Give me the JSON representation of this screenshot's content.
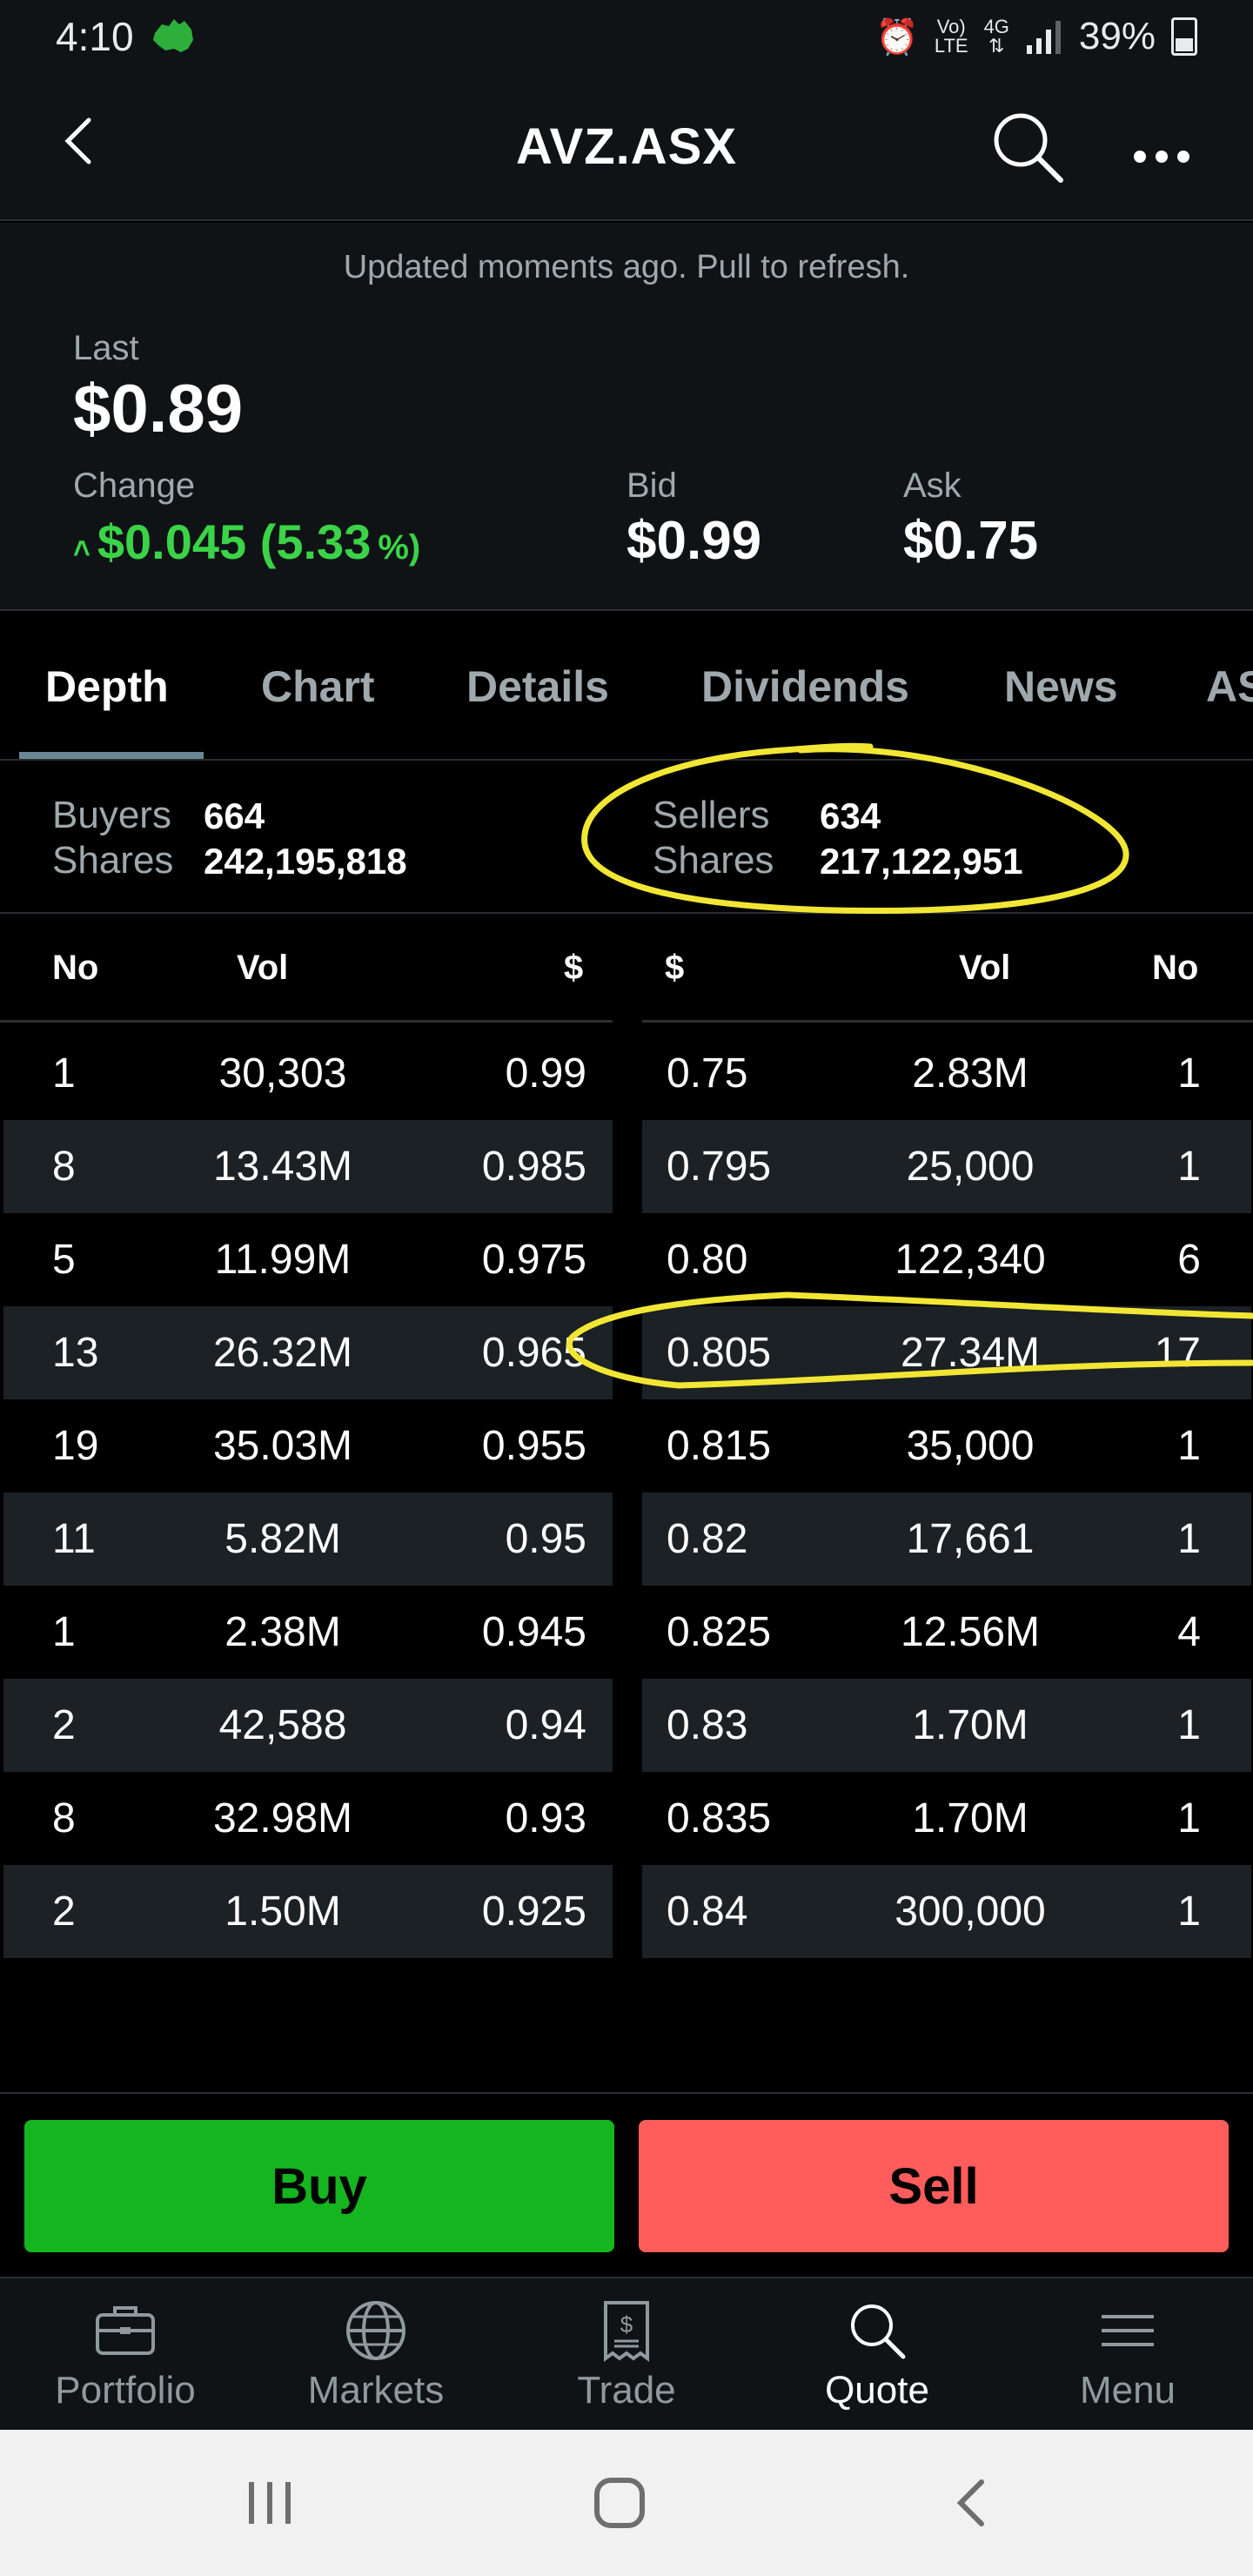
{
  "status_bar": {
    "time": "4:10",
    "lte_top": "Vo)",
    "lte_bottom": "LTE",
    "network": "4G",
    "battery": "39%"
  },
  "header": {
    "title": "AVZ.ASX"
  },
  "quote": {
    "updated_text": "Updated moments ago. Pull to refresh.",
    "last_label": "Last",
    "last_value": "$0.89",
    "change_label": "Change",
    "change_value": "$0.045 (5.33",
    "change_pct_sign": "%)",
    "bid_label": "Bid",
    "bid_value": "$0.99",
    "ask_label": "Ask",
    "ask_value": "$0.75",
    "change_color": "#3bd347"
  },
  "tabs": [
    {
      "label": "Depth",
      "active": true
    },
    {
      "label": "Chart",
      "active": false
    },
    {
      "label": "Details",
      "active": false
    },
    {
      "label": "Dividends",
      "active": false
    },
    {
      "label": "News",
      "active": false
    },
    {
      "label": "AS",
      "active": false
    }
  ],
  "summary": {
    "buyers_label": "Buyers",
    "buyers_value": "664",
    "buyers_shares_label": "Shares",
    "buyers_shares_value": "242,195,818",
    "sellers_label": "Sellers",
    "sellers_value": "634",
    "sellers_shares_label": "Shares",
    "sellers_shares_value": "217,122,951"
  },
  "depth_table": {
    "buy_headers": [
      "No",
      "Vol",
      "$"
    ],
    "sell_headers": [
      "$",
      "Vol",
      "No"
    ],
    "buy_rows": [
      [
        "1",
        "30,303",
        "0.99"
      ],
      [
        "8",
        "13.43M",
        "0.985"
      ],
      [
        "5",
        "11.99M",
        "0.975"
      ],
      [
        "13",
        "26.32M",
        "0.965"
      ],
      [
        "19",
        "35.03M",
        "0.955"
      ],
      [
        "11",
        "5.82M",
        "0.95"
      ],
      [
        "1",
        "2.38M",
        "0.945"
      ],
      [
        "2",
        "42,588",
        "0.94"
      ],
      [
        "8",
        "32.98M",
        "0.93"
      ],
      [
        "2",
        "1.50M",
        "0.925"
      ]
    ],
    "sell_rows": [
      [
        "0.75",
        "2.83M",
        "1"
      ],
      [
        "0.795",
        "25,000",
        "1"
      ],
      [
        "0.80",
        "122,340",
        "6"
      ],
      [
        "0.805",
        "27.34M",
        "17"
      ],
      [
        "0.815",
        "35,000",
        "1"
      ],
      [
        "0.82",
        "17,661",
        "1"
      ],
      [
        "0.825",
        "12.56M",
        "4"
      ],
      [
        "0.83",
        "1.70M",
        "1"
      ],
      [
        "0.835",
        "1.70M",
        "1"
      ],
      [
        "0.84",
        "300,000",
        "1"
      ]
    ]
  },
  "actions": {
    "buy_label": "Buy",
    "sell_label": "Sell",
    "buy_color": "#14b51e",
    "sell_color": "#ff5c5c"
  },
  "bottom_nav": [
    {
      "label": "Portfolio",
      "icon": "briefcase-icon",
      "active": false
    },
    {
      "label": "Markets",
      "icon": "globe-icon",
      "active": false
    },
    {
      "label": "Trade",
      "icon": "receipt-icon",
      "active": false
    },
    {
      "label": "Quote",
      "icon": "search-icon",
      "active": true
    },
    {
      "label": "Menu",
      "icon": "hamburger-icon",
      "active": false
    }
  ],
  "annotation_color": "#f2e635"
}
